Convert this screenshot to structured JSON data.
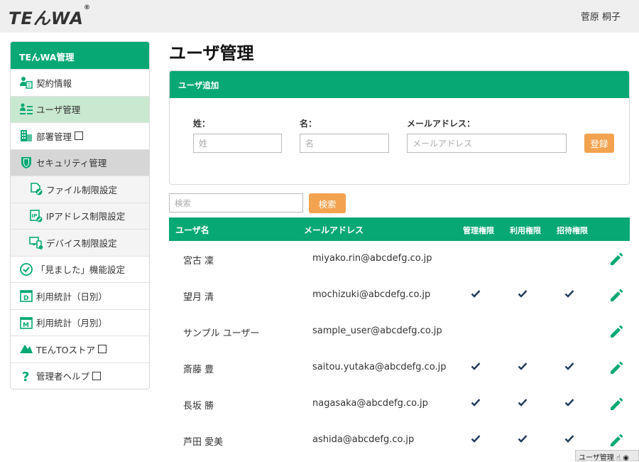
{
  "app": {
    "logo_main": "TEん",
    "logo_wa": "WA",
    "logo_mark": "®",
    "user_name": "菅原 桐子"
  },
  "sidebar": {
    "header": "TEんWA管理",
    "items": [
      {
        "label": "契約情報",
        "icon": "contract-icon"
      },
      {
        "label": "ユーザ管理",
        "icon": "user-list-icon"
      },
      {
        "label": "部署管理",
        "icon": "building-icon"
      },
      {
        "label": "セキュリティ管理",
        "icon": "shield-icon"
      },
      {
        "label": "ファイル制限設定",
        "icon": "file-block-icon"
      },
      {
        "label": "IPアドレス制限設定",
        "icon": "ip-icon"
      },
      {
        "label": "デバイス制限設定",
        "icon": "device-icon"
      },
      {
        "label": "「見ました」機能設定",
        "icon": "check-circle-icon"
      },
      {
        "label": "利用統計（日別）",
        "icon": "calendar-day-icon"
      },
      {
        "label": "利用統計（月別）",
        "icon": "calendar-month-icon"
      },
      {
        "label": "TEんTOストア",
        "icon": "store-icon"
      },
      {
        "label": "管理者ヘルプ",
        "icon": "help-icon"
      }
    ]
  },
  "page": {
    "title": "ユーザ管理"
  },
  "add_user": {
    "header": "ユーザ追加",
    "last_name_label": "姓：",
    "last_name_placeholder": "姓",
    "first_name_label": "名：",
    "first_name_placeholder": "名",
    "email_label": "メールアドレス：",
    "email_placeholder": "メールアドレス",
    "register_label": "登録"
  },
  "search": {
    "placeholder": "検索",
    "button_label": "検索"
  },
  "table": {
    "columns": [
      "ユーザ名",
      "メールアドレス",
      "管理権限",
      "利用権限",
      "招待権限"
    ],
    "rows": [
      {
        "name": "宮古 凜",
        "email": "miyako.rin@abcdefg.co.jp",
        "admin": false,
        "use": false,
        "invite": false
      },
      {
        "name": "望月 清",
        "email": "mochizuki@abcdefg.co.jp",
        "admin": true,
        "use": true,
        "invite": true
      },
      {
        "name": "サンプル ユーザー",
        "email": "sample_user@abcdefg.co.jp",
        "admin": false,
        "use": false,
        "invite": false
      },
      {
        "name": "斎藤 豊",
        "email": "saitou.yutaka@abcdefg.co.jp",
        "admin": true,
        "use": true,
        "invite": true
      },
      {
        "name": "長坂 勝",
        "email": "nagasaka@abcdefg.co.jp",
        "admin": true,
        "use": true,
        "invite": true
      },
      {
        "name": "芦田 愛美",
        "email": "ashida@abcdefg.co.jp",
        "admin": true,
        "use": true,
        "invite": true
      }
    ]
  },
  "status": {
    "label": "ユーザ管理"
  },
  "colors": {
    "brand_green": "#07a874",
    "accent_orange": "#f3a24f",
    "check_navy": "#1f3a5a"
  }
}
